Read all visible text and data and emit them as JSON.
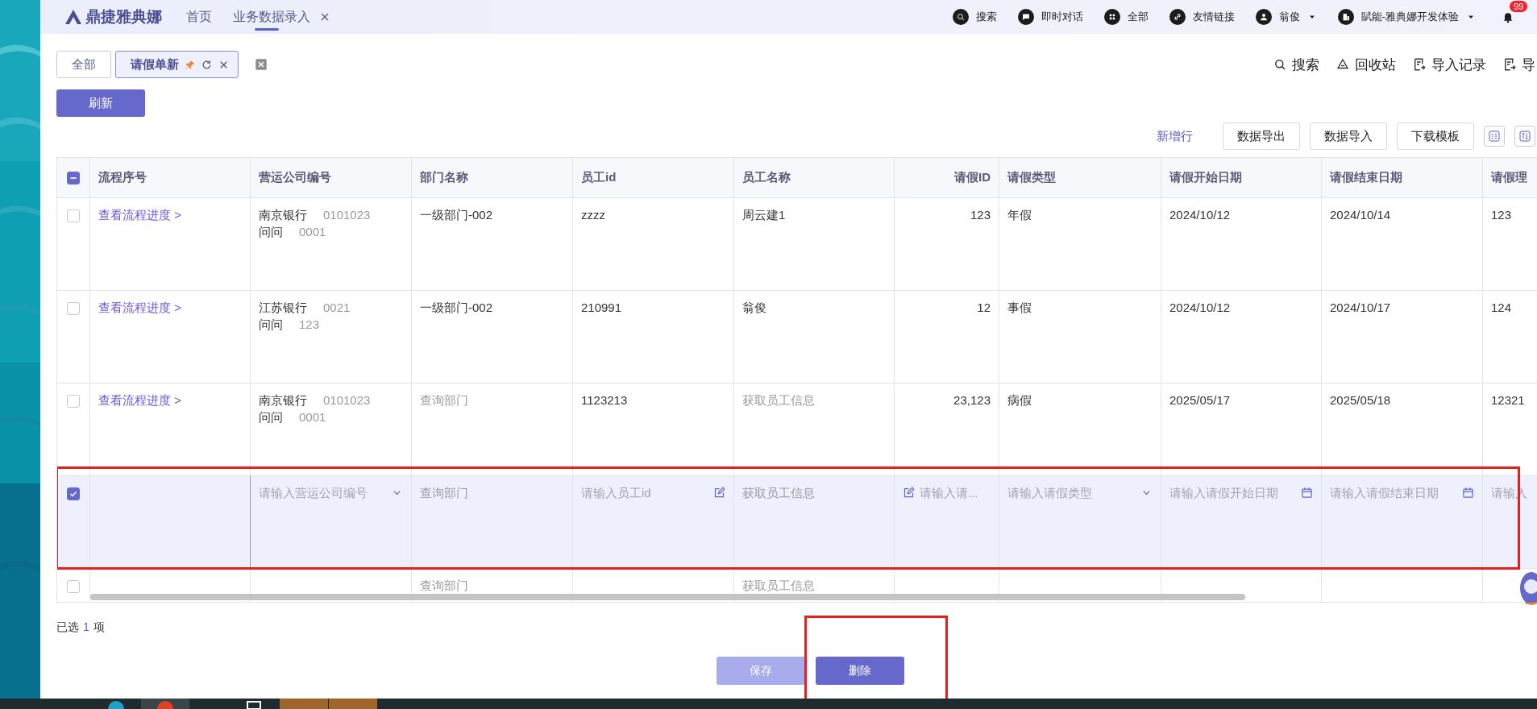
{
  "app": {
    "logo": "鼎捷雅典娜",
    "nav_tabs": [
      {
        "label": "首页",
        "selected": false
      },
      {
        "label": "业务数据录入",
        "selected": true
      }
    ],
    "top_actions": [
      {
        "label": "搜索",
        "dropdown": false
      },
      {
        "label": "即时对话",
        "dropdown": false
      },
      {
        "label": "全部",
        "dropdown": false
      },
      {
        "label": "友情链接",
        "dropdown": false
      },
      {
        "label": "翁俊",
        "dropdown": true
      },
      {
        "label": "賦能-雅典娜开发体验",
        "dropdown": true
      }
    ],
    "notification_badge": "99"
  },
  "page_tabs": [
    {
      "label": "全部",
      "selected": false,
      "pinned": false
    },
    {
      "label": "请假单新",
      "selected": true,
      "pinned": true
    }
  ],
  "page_actions": [
    {
      "label": "搜索"
    },
    {
      "label": "回收站"
    },
    {
      "label": "导入记录"
    },
    {
      "label": "导"
    }
  ],
  "refresh_button": "刷新",
  "table_toolbar": {
    "add_row": "新增行",
    "buttons": [
      "数据导出",
      "数据导入",
      "下载模板"
    ]
  },
  "table": {
    "select_all_partial": true,
    "columns": [
      {
        "label": "流程序号",
        "kind": "link"
      },
      {
        "label": "营运公司编号",
        "kind": "company"
      },
      {
        "label": "部门名称",
        "kind": "text"
      },
      {
        "label": "员工id",
        "kind": "text"
      },
      {
        "label": "员工名称",
        "kind": "text"
      },
      {
        "label": "请假ID",
        "kind": "number"
      },
      {
        "label": "请假类型",
        "kind": "text"
      },
      {
        "label": "请假开始日期",
        "kind": "text"
      },
      {
        "label": "请假结束日期",
        "kind": "text"
      },
      {
        "label": "请假理",
        "kind": "text"
      }
    ],
    "rows": [
      {
        "kind": "data",
        "checked": false,
        "highlighted": false,
        "cells": [
          {
            "text": "查看流程进度 >"
          },
          {
            "lines": [
              {
                "name": "南京银行",
                "code": "0101023"
              },
              {
                "name": "问问",
                "code": "0001"
              }
            ]
          },
          {
            "text": "一级部门-002"
          },
          {
            "text": "zzzz"
          },
          {
            "text": "周云建1"
          },
          {
            "text": "123"
          },
          {
            "text": "年假"
          },
          {
            "text": "2024/10/12"
          },
          {
            "text": "2024/10/14"
          },
          {
            "text": "123"
          }
        ]
      },
      {
        "kind": "data",
        "checked": false,
        "highlighted": false,
        "cells": [
          {
            "text": "查看流程进度 >"
          },
          {
            "lines": [
              {
                "name": "江苏银行",
                "code": "0021"
              },
              {
                "name": "问问",
                "code": "123"
              }
            ]
          },
          {
            "text": "一级部门-002"
          },
          {
            "text": "210991"
          },
          {
            "text": "翁俊"
          },
          {
            "text": "12"
          },
          {
            "text": "事假"
          },
          {
            "text": "2024/10/12"
          },
          {
            "text": "2024/10/17"
          },
          {
            "text": "124"
          }
        ]
      },
      {
        "kind": "data",
        "checked": false,
        "highlighted": false,
        "cells": [
          {
            "text": "查看流程进度 >"
          },
          {
            "lines": [
              {
                "name": "南京银行",
                "code": "0101023"
              },
              {
                "name": "问问",
                "code": "0001"
              }
            ]
          },
          {
            "text": "查询部门",
            "muted": true
          },
          {
            "text": "1123213"
          },
          {
            "text": "获取员工信息",
            "muted": true
          },
          {
            "text": "23,123"
          },
          {
            "text": "病假"
          },
          {
            "text": "2025/05/17"
          },
          {
            "text": "2025/05/18"
          },
          {
            "text": "12321"
          }
        ]
      },
      {
        "kind": "edit",
        "checked": true,
        "highlighted": true,
        "cells": [
          null,
          {
            "kind": "select",
            "placeholder": "请输入营运公司编号"
          },
          {
            "text": "查询部门",
            "muted": true
          },
          {
            "kind": "input",
            "placeholder": "请输入员工id"
          },
          {
            "text": "获取员工信息",
            "muted": true
          },
          {
            "kind": "input_leading",
            "placeholder": "请输入请..."
          },
          {
            "kind": "select",
            "placeholder": "请输入请假类型"
          },
          {
            "kind": "date",
            "placeholder": "请输入请假开始日期"
          },
          {
            "kind": "date",
            "placeholder": "请输入请假结束日期"
          },
          {
            "kind": "plain",
            "placeholder": "请输入"
          }
        ]
      },
      {
        "kind": "data",
        "checked": false,
        "highlighted": false,
        "cells": [
          null,
          null,
          {
            "text": "查询部门",
            "muted": true
          },
          null,
          {
            "text": "获取员工信息",
            "muted": true
          },
          null,
          null,
          null,
          null,
          null
        ]
      }
    ]
  },
  "footer": {
    "selected_prefix": "已选",
    "selected_count": "1",
    "selected_suffix": "项",
    "buttons": [
      {
        "label": "保存",
        "disabled": true,
        "highlighted": false
      },
      {
        "label": "删除",
        "disabled": false,
        "highlighted": true
      }
    ]
  }
}
